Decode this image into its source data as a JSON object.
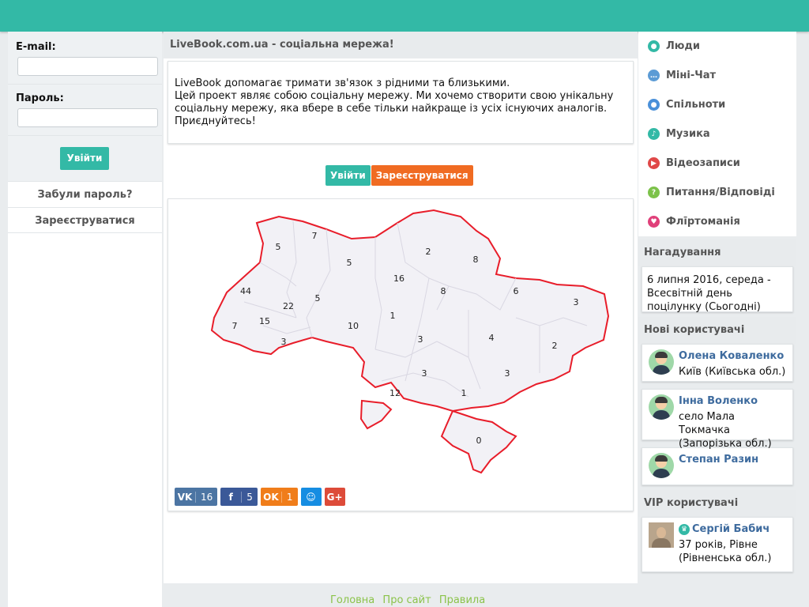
{
  "login": {
    "email_label": "E-mail:",
    "password_label": "Пароль:",
    "enter_button": "Увійти",
    "forgot_link": "Забули пароль?",
    "register_link": "Зареєструватися"
  },
  "main": {
    "title": "LiveBook.com.ua - соціальна мережа!",
    "intro": "LiveBook допомагає тримати зв'язок з рідними та близькими.\nЦей проект являє собою соціальну мережу. Ми хочемо створити свою унікальну соціальну мережу, яка вбере в себе тільки найкраще із усіх існуючих аналогів.\nПриєднуйтесь!",
    "login_button": "Увійти",
    "register_button": "Зареєструватися"
  },
  "map": {
    "region_counts": [
      "5",
      "7",
      "5",
      "2",
      "8",
      "16",
      "8",
      "6",
      "3",
      "44",
      "22",
      "5",
      "1",
      "10",
      "7",
      "15",
      "3",
      "3",
      "4",
      "2",
      "3",
      "3",
      "12",
      "1",
      "0"
    ]
  },
  "share": [
    {
      "icon": "vk-icon",
      "label": "VK",
      "count": "16",
      "color": "#4c75a3"
    },
    {
      "icon": "facebook-icon",
      "label": "f",
      "count": "5",
      "color": "#3b5998"
    },
    {
      "icon": "odnoklassniki-icon",
      "label": "OK",
      "count": "1",
      "color": "#f07d1a"
    },
    {
      "icon": "moimir-icon",
      "label": "☺",
      "count": "",
      "color": "#168de2"
    },
    {
      "icon": "googleplus-icon",
      "label": "G+",
      "count": "",
      "color": "#dd4b39"
    }
  ],
  "menu": [
    {
      "label": "Люди",
      "icon": "people-icon",
      "color": "#33b9a6",
      "glyph": "●"
    },
    {
      "label": "Міні-Чат",
      "icon": "chat-icon",
      "color": "#5b9bd5",
      "glyph": "…"
    },
    {
      "label": "Спільноти",
      "icon": "communities-icon",
      "color": "#4a90d9",
      "glyph": "●"
    },
    {
      "label": "Музика",
      "icon": "music-icon",
      "color": "#33b9a6",
      "glyph": "♪"
    },
    {
      "label": "Відеозаписи",
      "icon": "video-icon",
      "color": "#e04848",
      "glyph": "▶"
    },
    {
      "label": "Питання/Відповіді",
      "icon": "question-icon",
      "color": "#7cc24a",
      "glyph": "?"
    },
    {
      "label": "Флīртоманія",
      "icon": "heart-icon",
      "color": "#e0407a",
      "glyph": "♥"
    }
  ],
  "reminders": {
    "title": "Нагадування",
    "text": "6 липня 2016, середа - Всесвітній день поцілунку (Сьогодні)"
  },
  "new_users": {
    "title": "Нові користувачі",
    "items": [
      {
        "name": "Олена Коваленко",
        "city": "Київ (Київська обл.)"
      },
      {
        "name": "Інна Воленко",
        "city": "село Мала Токмачка (Запорізька обл.)"
      },
      {
        "name": "Степан Разин",
        "city": ""
      }
    ]
  },
  "vip_users": {
    "title": "VIP користувачі",
    "items": [
      {
        "name": "Сергій Бабич",
        "city": "37 років, Рівне (Рівненська обл.)"
      }
    ]
  },
  "footer": [
    "Головна",
    "Про сайт",
    "Правила"
  ]
}
